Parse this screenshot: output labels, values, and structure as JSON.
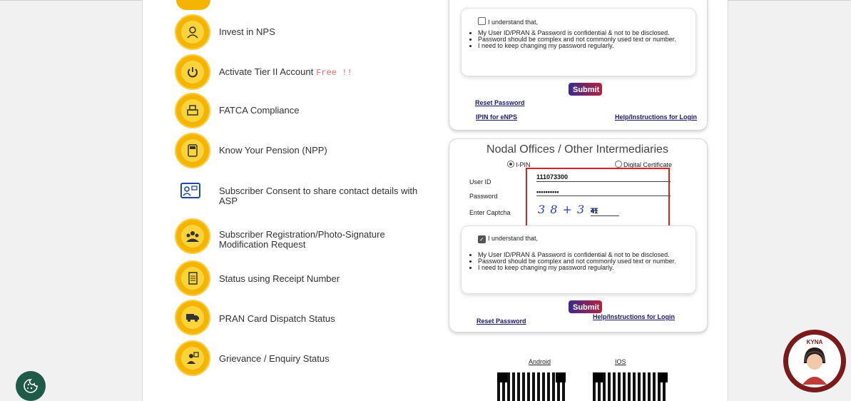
{
  "services": [
    {
      "label": "Invest in NPS",
      "icon": "invest-icon"
    },
    {
      "label": "Activate Tier II Account",
      "badge": "Free !!",
      "icon": "power-icon"
    },
    {
      "label": "FATCA Compliance",
      "icon": "printer-icon"
    },
    {
      "label": "Know Your Pension (NPP)",
      "icon": "calculator-icon"
    },
    {
      "label": "Subscriber Consent to share contact details with ASP",
      "icon": "contact-card-icon"
    },
    {
      "label": "Subscriber Registration/Photo-Signature Modification Request",
      "icon": "group-icon"
    },
    {
      "label": "Status using Receipt Number",
      "icon": "receipt-icon"
    },
    {
      "label": "PRAN Card Dispatch Status",
      "icon": "truck-icon"
    },
    {
      "label": "Grievance / Enquiry Status",
      "icon": "grievance-icon"
    }
  ],
  "subscriber_login": {
    "understand": "I understand that,",
    "points": [
      "My User ID/PRAN & Password is confidential & not to be disclosed.",
      "Password should be complex and not commonly used text or number.",
      "I need to keep changing my password regularly."
    ],
    "submit": "Submit",
    "reset_password": "Reset Password",
    "ipin_enps": "IPIN for eNPS",
    "help": "Help/Instructions for Login"
  },
  "nodal": {
    "title": "Nodal Offices / Other Intermediaries",
    "radio_ipin": "I-PIN",
    "radio_dc": "Digital Certificate",
    "user_id_label": "User ID",
    "user_id_value": "111073300",
    "password_label": "Password",
    "password_value": "••••••••••",
    "captcha_label": "Enter Captcha",
    "captcha_text": "3 8 + 3 =",
    "captcha_answer": "41",
    "understand": "I understand that,",
    "points": [
      "My User ID/PRAN & Password is confidential & not to be disclosed.",
      "Password should be complex and not commonly used text or number.",
      "I need to keep changing my password regularly."
    ],
    "submit": "Submit",
    "reset_password": "Reset Password",
    "help": "Help/Instructions for Login"
  },
  "apps": {
    "android": "Android",
    "ios": "IOS"
  },
  "chatbot": {
    "name": "KYNA"
  }
}
